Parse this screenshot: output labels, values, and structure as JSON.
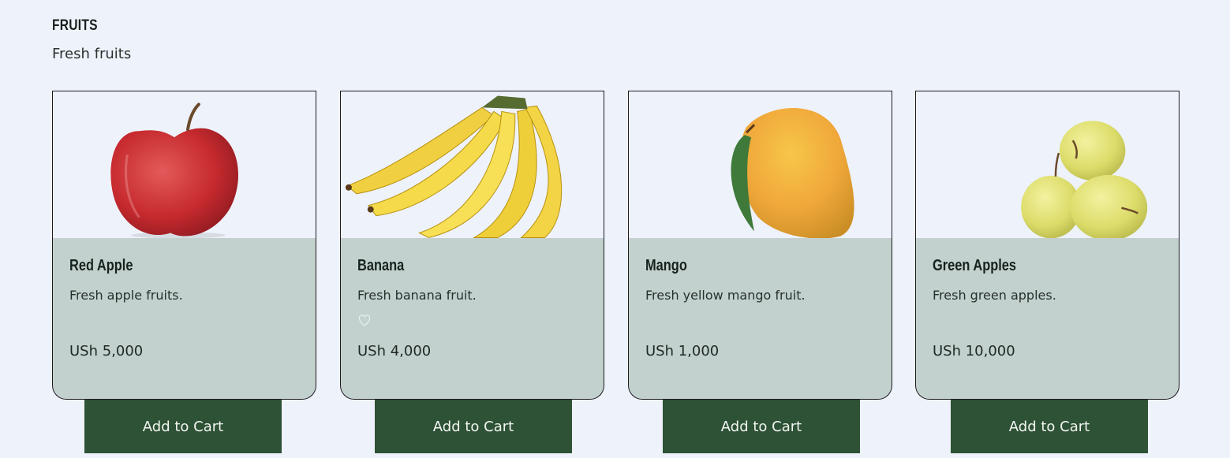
{
  "section": {
    "title": "FRUITS",
    "subtitle": "Fresh fruits"
  },
  "products": [
    {
      "name": "Red Apple",
      "description": "Fresh apple fruits.",
      "price": "USh 5,000",
      "button": "Add to Cart",
      "image_icon": "red-apple-image"
    },
    {
      "name": "Banana",
      "description": "Fresh banana fruit.",
      "price": "USh 4,000",
      "button": "Add to Cart",
      "image_icon": "banana-image"
    },
    {
      "name": "Mango",
      "description": "Fresh yellow mango fruit.",
      "price": "USh 1,000",
      "button": "Add to Cart",
      "image_icon": "mango-image"
    },
    {
      "name": "Green Apples",
      "description": "Fresh green apples.",
      "price": "USh 10,000",
      "button": "Add to Cart",
      "image_icon": "green-apples-image"
    }
  ],
  "colors": {
    "background": "#eef2fa",
    "card_body": "#c3d1ce",
    "button": "#2e5236",
    "button_text": "#f2f5f1"
  }
}
